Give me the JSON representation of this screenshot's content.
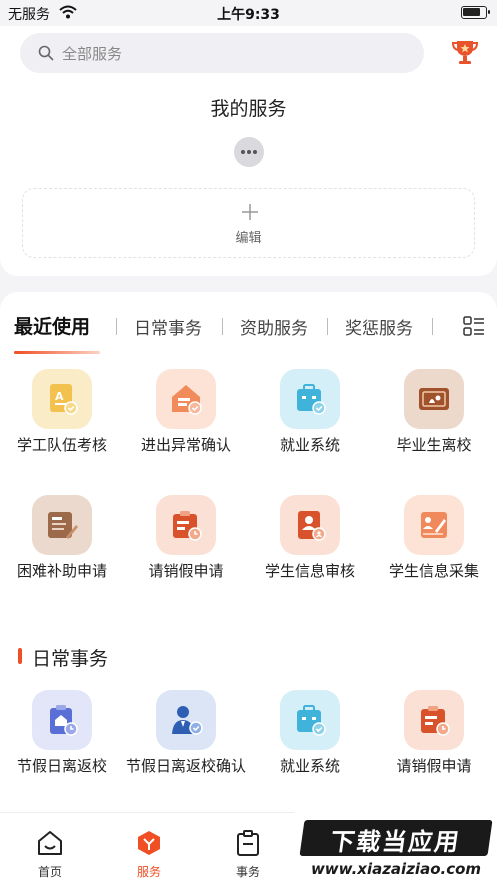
{
  "status_bar": {
    "carrier": "无服务",
    "time": "上午9:33"
  },
  "search": {
    "placeholder": "全部服务"
  },
  "my_services": {
    "title": "我的服务",
    "edit_label": "编辑"
  },
  "tabs": [
    {
      "label": "最近使用",
      "active": true
    },
    {
      "label": "日常事务",
      "active": false
    },
    {
      "label": "资助服务",
      "active": false
    },
    {
      "label": "奖惩服务",
      "active": false
    }
  ],
  "recent": [
    {
      "label": "学工队伍考核",
      "icon": "grade-certificate-icon",
      "color": "#f2c14e"
    },
    {
      "label": "进出异常确认",
      "icon": "house-check-icon",
      "color": "#f28b5b"
    },
    {
      "label": "就业系统",
      "icon": "briefcase-check-icon",
      "color": "#3fb3d9"
    },
    {
      "label": "毕业生离校",
      "icon": "diploma-icon",
      "color": "#a0522d"
    },
    {
      "label": "困难补助申请",
      "icon": "form-pen-icon",
      "color": "#9c6a4a"
    },
    {
      "label": "请销假申请",
      "icon": "leave-clock-icon",
      "color": "#d8532c"
    },
    {
      "label": "学生信息审核",
      "icon": "profile-verify-icon",
      "color": "#d8532c"
    },
    {
      "label": "学生信息采集",
      "icon": "profile-edit-icon",
      "color": "#f08a5d"
    }
  ],
  "daily_section": {
    "title": "日常事务",
    "items": [
      {
        "label": "节假日离返校",
        "icon": "holiday-return-icon",
        "color": "#5a6fd6"
      },
      {
        "label": "节假日离返校确认",
        "icon": "person-check-icon",
        "color": "#2f5fb3"
      },
      {
        "label": "就业系统",
        "icon": "briefcase-check-icon",
        "color": "#3fb3d9"
      },
      {
        "label": "请销假申请",
        "icon": "leave-clock-icon",
        "color": "#d8532c"
      }
    ]
  },
  "bottom_nav": [
    {
      "label": "首页",
      "icon": "home-icon",
      "active": false
    },
    {
      "label": "服务",
      "icon": "services-icon",
      "active": true
    },
    {
      "label": "事务",
      "icon": "clipboard-icon",
      "active": false
    }
  ],
  "watermark": {
    "brand": "下载当应用",
    "url": "www.xiazaiziao.com"
  },
  "colors": {
    "accent": "#f04e23"
  }
}
